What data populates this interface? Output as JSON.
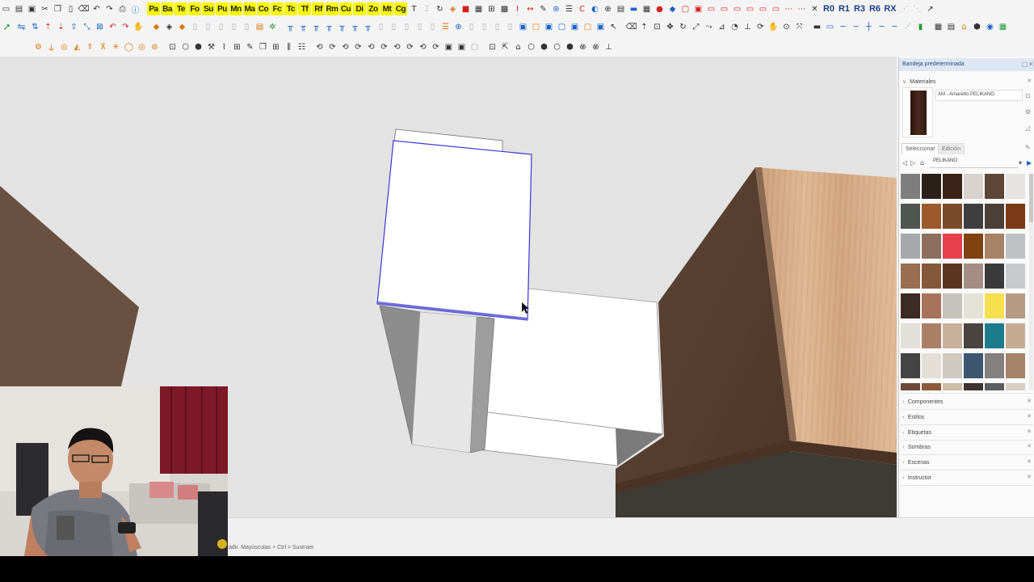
{
  "toolbar_row1": {
    "plugin_labels": [
      "Pa",
      "Ba",
      "Te",
      "Fo",
      "Su",
      "Pu",
      "Mn",
      "Ma",
      "Co",
      "Fc",
      "Tc",
      "Tf",
      "Rf",
      "Rm",
      "Cu",
      "Di",
      "Zo",
      "Mt",
      "Cg"
    ],
    "rotate_labels": [
      "R0",
      "R1",
      "R3",
      "R6",
      "RX"
    ]
  },
  "tray": {
    "title": "Bandeja predeterminada",
    "materials": {
      "header": "Materiales",
      "current_material": "AM - Amaretto PELIKANO",
      "tab_select": "Seleccionar",
      "tab_edit": "Edición",
      "library": "PELIKANO",
      "swatches": [
        "#7e7e7e",
        "#2b1f19",
        "#3b2116",
        "#d8d3cf",
        "#5e4636",
        "#e6e4e1",
        "#4f5550",
        "#9c5a2c",
        "#7a4a2a",
        "#3e3e3e",
        "#4a4038",
        "#7a3a16",
        "#a7a9ad",
        "#8c6f5d",
        "#e7404d",
        "#80420f",
        "#a88264",
        "#bfc2c5",
        "#9a6e50",
        "#85583a",
        "#5a3520",
        "#a58d84",
        "#3a3a3a",
        "#c6cacd",
        "#3d2a24",
        "#a8735b",
        "#c6c2bc",
        "#e2e2d6",
        "#f4df4e",
        "#b59a84",
        "#e3e0d9",
        "#a98066",
        "#c8b19a",
        "#4a4440",
        "#1d7b8d",
        "#c4ab92",
        "#444444",
        "#e4dfd6",
        "#cfc9c0",
        "#3c5670",
        "#858080",
        "#a48368",
        "#6b4a3a",
        "#8a5a3a",
        "#cdbda8",
        "#3a3432",
        "#5b5c60",
        "#d7cec5"
      ]
    },
    "sections": [
      "Componentes",
      "Estilos",
      "Etiquetas",
      "Sombras",
      "Escenas",
      "Instructor"
    ]
  },
  "status": {
    "hint": "adir. Mayúsculas + Ctrl = Sustraer."
  }
}
